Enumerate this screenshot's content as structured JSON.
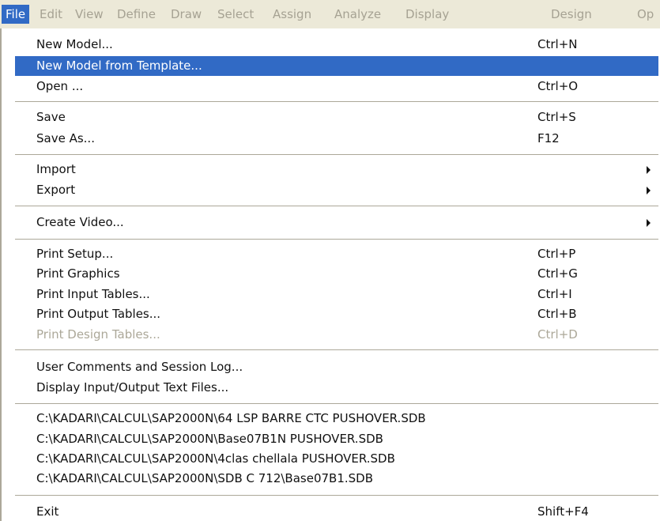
{
  "menubar": {
    "items": [
      "File",
      "Edit",
      "View",
      "Define",
      "Draw",
      "Select",
      "Assign",
      "Analyze",
      "Display",
      "Design",
      "Op"
    ],
    "active": "File"
  },
  "file_menu": {
    "new_model": {
      "label": "New Model...",
      "shortcut": "Ctrl+N"
    },
    "new_model_template": {
      "label": "New Model from Template..."
    },
    "open": {
      "label": "Open ...",
      "shortcut": "Ctrl+O"
    },
    "save": {
      "label": "Save",
      "shortcut": "Ctrl+S"
    },
    "save_as": {
      "label": "Save As...",
      "shortcut": "F12"
    },
    "import": {
      "label": "Import"
    },
    "export": {
      "label": "Export"
    },
    "create_video": {
      "label": "Create Video..."
    },
    "print_setup": {
      "label": "Print Setup...",
      "shortcut": "Ctrl+P"
    },
    "print_graphics": {
      "label": "Print Graphics",
      "shortcut": "Ctrl+G"
    },
    "print_input_tables": {
      "label": "Print Input Tables...",
      "shortcut": "Ctrl+I"
    },
    "print_output_tables": {
      "label": "Print Output Tables...",
      "shortcut": "Ctrl+B"
    },
    "print_design_tables": {
      "label": "Print Design Tables...",
      "shortcut": "Ctrl+D"
    },
    "user_comments": {
      "label": "User Comments and Session Log..."
    },
    "display_io_files": {
      "label": "Display Input/Output Text Files..."
    },
    "recent_files": [
      "C:\\KADARI\\CALCUL\\SAP2000N\\64 LSP BARRE CTC PUSHOVER.SDB",
      "C:\\KADARI\\CALCUL\\SAP2000N\\Base07B1N PUSHOVER.SDB",
      "C:\\KADARI\\CALCUL\\SAP2000N\\4clas chellala PUSHOVER.SDB",
      "C:\\KADARI\\CALCUL\\SAP2000N\\SDB C 712\\Base07B1.SDB"
    ],
    "exit": {
      "label": "Exit",
      "shortcut": "Shift+F4"
    }
  },
  "colors": {
    "highlight": "#316ac5",
    "menubar_bg": "#ece9d8",
    "disabled_text": "#aca899"
  }
}
